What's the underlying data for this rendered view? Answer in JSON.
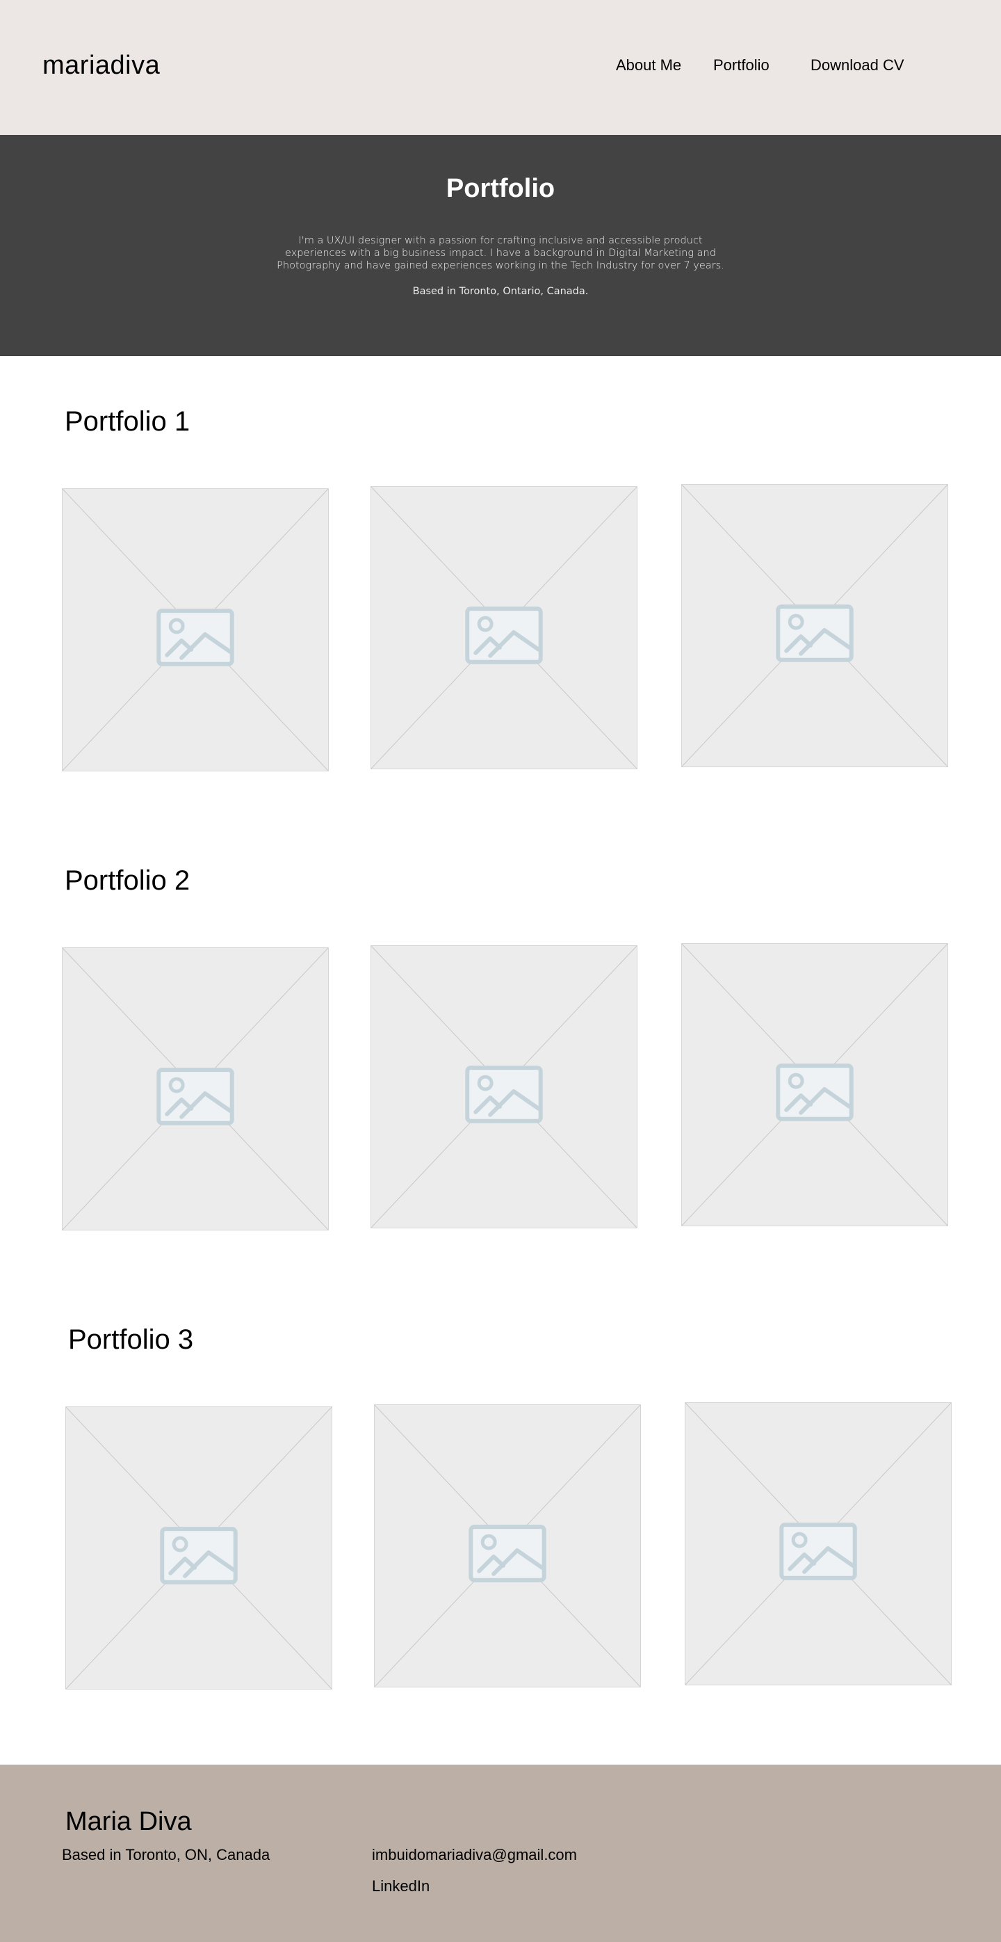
{
  "header": {
    "logo": "mariadiva",
    "nav": [
      "About Me",
      "Portfolio",
      "Download CV"
    ]
  },
  "hero": {
    "title": "Portfolio",
    "description": "I'm a UX/UI designer with a passion for crafting inclusive and accessible product experiences with a big business impact. I have a background in Digital Marketing and Photography and have gained experiences working in the Tech Industry for over 7 years.",
    "location": "Based in Toronto, Ontario, Canada."
  },
  "sections": [
    {
      "title": "Portfolio 1",
      "images": [
        "image-placeholder-icon",
        "image-placeholder-icon",
        "image-placeholder-icon"
      ]
    },
    {
      "title": "Portfolio 2",
      "images": [
        "image-placeholder-icon",
        "image-placeholder-icon",
        "image-placeholder-icon"
      ]
    },
    {
      "title": "Portfolio 3",
      "images": [
        "image-placeholder-icon",
        "image-placeholder-icon",
        "image-placeholder-icon"
      ]
    }
  ],
  "footer": {
    "name": "Maria Diva",
    "location": "Based in Toronto, ON, Canada",
    "email": "imbuidomariadiva@gmail.com",
    "linkedin": "LinkedIn"
  },
  "colors": {
    "header_bg": "#ece7e4",
    "hero_bg": "#434343",
    "footer_bg": "#bcafa6",
    "placeholder_bg": "#ececec",
    "placeholder_icon": "#c5d3da"
  }
}
